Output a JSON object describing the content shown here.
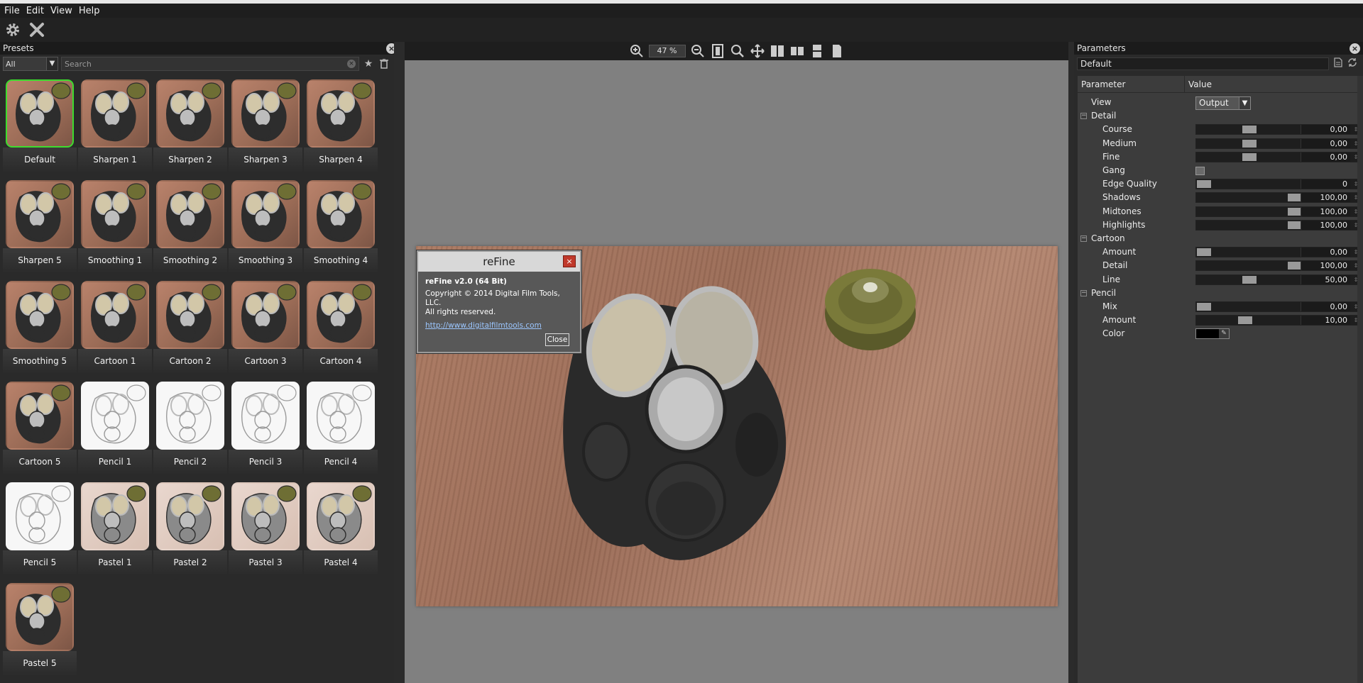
{
  "menu": [
    "File",
    "Edit",
    "View",
    "Help"
  ],
  "presets_panel": {
    "title": "Presets",
    "filter": "All",
    "search_placeholder": "Search",
    "items": [
      {
        "label": "Default",
        "style": "photo",
        "selected": true
      },
      {
        "label": "Sharpen 1",
        "style": "photo"
      },
      {
        "label": "Sharpen 2",
        "style": "photo"
      },
      {
        "label": "Sharpen 3",
        "style": "photo"
      },
      {
        "label": "Sharpen 4",
        "style": "photo"
      },
      {
        "label": "Sharpen 5",
        "style": "photo"
      },
      {
        "label": "Smoothing 1",
        "style": "photo"
      },
      {
        "label": "Smoothing 2",
        "style": "photo"
      },
      {
        "label": "Smoothing 3",
        "style": "photo"
      },
      {
        "label": "Smoothing 4",
        "style": "photo"
      },
      {
        "label": "Smoothing 5",
        "style": "photo"
      },
      {
        "label": "Cartoon 1",
        "style": "photo"
      },
      {
        "label": "Cartoon 2",
        "style": "photo"
      },
      {
        "label": "Cartoon 3",
        "style": "photo"
      },
      {
        "label": "Cartoon 4",
        "style": "photo"
      },
      {
        "label": "Cartoon 5",
        "style": "photo"
      },
      {
        "label": "Pencil 1",
        "style": "pencil"
      },
      {
        "label": "Pencil 2",
        "style": "pencil"
      },
      {
        "label": "Pencil 3",
        "style": "pencil"
      },
      {
        "label": "Pencil 4",
        "style": "pencil"
      },
      {
        "label": "Pencil 5",
        "style": "pencil"
      },
      {
        "label": "Pastel 1",
        "style": "pastel"
      },
      {
        "label": "Pastel 2",
        "style": "pastel"
      },
      {
        "label": "Pastel 3",
        "style": "pastel"
      },
      {
        "label": "Pastel 4",
        "style": "pastel"
      },
      {
        "label": "Pastel 5",
        "style": "photo"
      }
    ]
  },
  "viewer": {
    "zoom": "47 %"
  },
  "about_dialog": {
    "title": "reFine",
    "product": "reFine v2.0 (64 Bit)",
    "copyright": "Copyright © 2014 Digital Film Tools, LLC.",
    "rights": "All rights reserved.",
    "link": "http://www.digitalfilmtools.com",
    "close_label": "Close"
  },
  "parameters_panel": {
    "title": "Parameters",
    "preset_name": "Default",
    "col_parameter": "Parameter",
    "col_value": "Value",
    "rows": [
      {
        "name": "View",
        "type": "select",
        "value": "Output",
        "indent": 1
      },
      {
        "name": "Detail",
        "type": "group",
        "indent": 0
      },
      {
        "name": "Course",
        "type": "slider",
        "value": "0,00",
        "level": 0.5,
        "indent": 2
      },
      {
        "name": "Medium",
        "type": "slider",
        "value": "0,00",
        "level": 0.5,
        "indent": 2
      },
      {
        "name": "Fine",
        "type": "slider",
        "value": "0,00",
        "level": 0.5,
        "indent": 2
      },
      {
        "name": "Gang",
        "type": "checkbox",
        "indent": 2
      },
      {
        "name": "Edge Quality",
        "type": "slider",
        "value": "0",
        "level": 0.0,
        "indent": 2
      },
      {
        "name": "Shadows",
        "type": "slider",
        "value": "100,00",
        "level": 1.0,
        "indent": 2
      },
      {
        "name": "Midtones",
        "type": "slider",
        "value": "100,00",
        "level": 1.0,
        "indent": 2
      },
      {
        "name": "Highlights",
        "type": "slider",
        "value": "100,00",
        "level": 1.0,
        "indent": 2
      },
      {
        "name": "Cartoon",
        "type": "group",
        "indent": 0
      },
      {
        "name": "Amount",
        "type": "slider",
        "value": "0,00",
        "level": 0.0,
        "indent": 2
      },
      {
        "name": "Detail",
        "type": "slider",
        "value": "100,00",
        "level": 1.0,
        "indent": 2
      },
      {
        "name": "Line",
        "type": "slider",
        "value": "50,00",
        "level": 0.5,
        "indent": 2
      },
      {
        "name": "Pencil",
        "type": "group",
        "indent": 0
      },
      {
        "name": "Mix",
        "type": "slider",
        "value": "0,00",
        "level": 0.0,
        "indent": 2
      },
      {
        "name": "Amount",
        "type": "slider",
        "value": "10,00",
        "level": 0.45,
        "indent": 2
      },
      {
        "name": "Color",
        "type": "color",
        "value": "#000000",
        "indent": 2
      }
    ]
  },
  "colors": {
    "selected_border": "#3ddc2e",
    "dialog_close": "#c0392b"
  }
}
